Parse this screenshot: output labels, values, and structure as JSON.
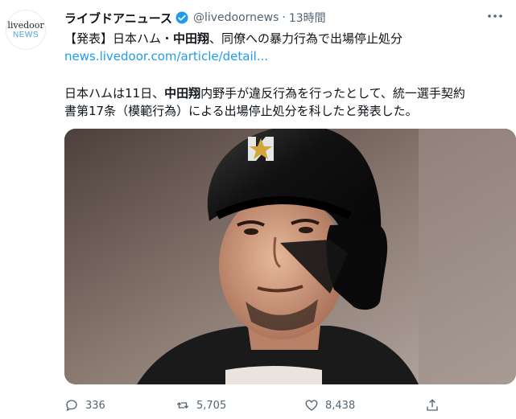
{
  "account": {
    "avatar_line1": "livedoor",
    "avatar_line2": "NEWS",
    "display_name": "ライブドアニュース",
    "handle": "@livedoornews",
    "separator": "·",
    "time": "13時間"
  },
  "tweet": {
    "headline_prefix": "【発表】日本ハム・",
    "headline_bold": "中田翔",
    "headline_suffix": "、同僚への暴力行為で出場停止処分",
    "link": "news.livedoor.com/article/detail...",
    "body_prefix": "日本ハムは11日、",
    "body_bold": "中田翔",
    "body_line1_suffix": "内野手が違反行為を行ったとして、統一選手契約",
    "body_line2": "書第17条（模範行為）による出場停止処分を科したと発表した。"
  },
  "stats": {
    "replies": "336",
    "retweets": "5,705",
    "likes": "8,438"
  },
  "colors": {
    "link": "#1d9bf0",
    "verified": "#1d9bf0",
    "secondary_text": "#536471"
  },
  "icons": [
    "verified-badge-icon",
    "more-icon",
    "reply-icon",
    "retweet-icon",
    "like-icon",
    "share-icon"
  ]
}
